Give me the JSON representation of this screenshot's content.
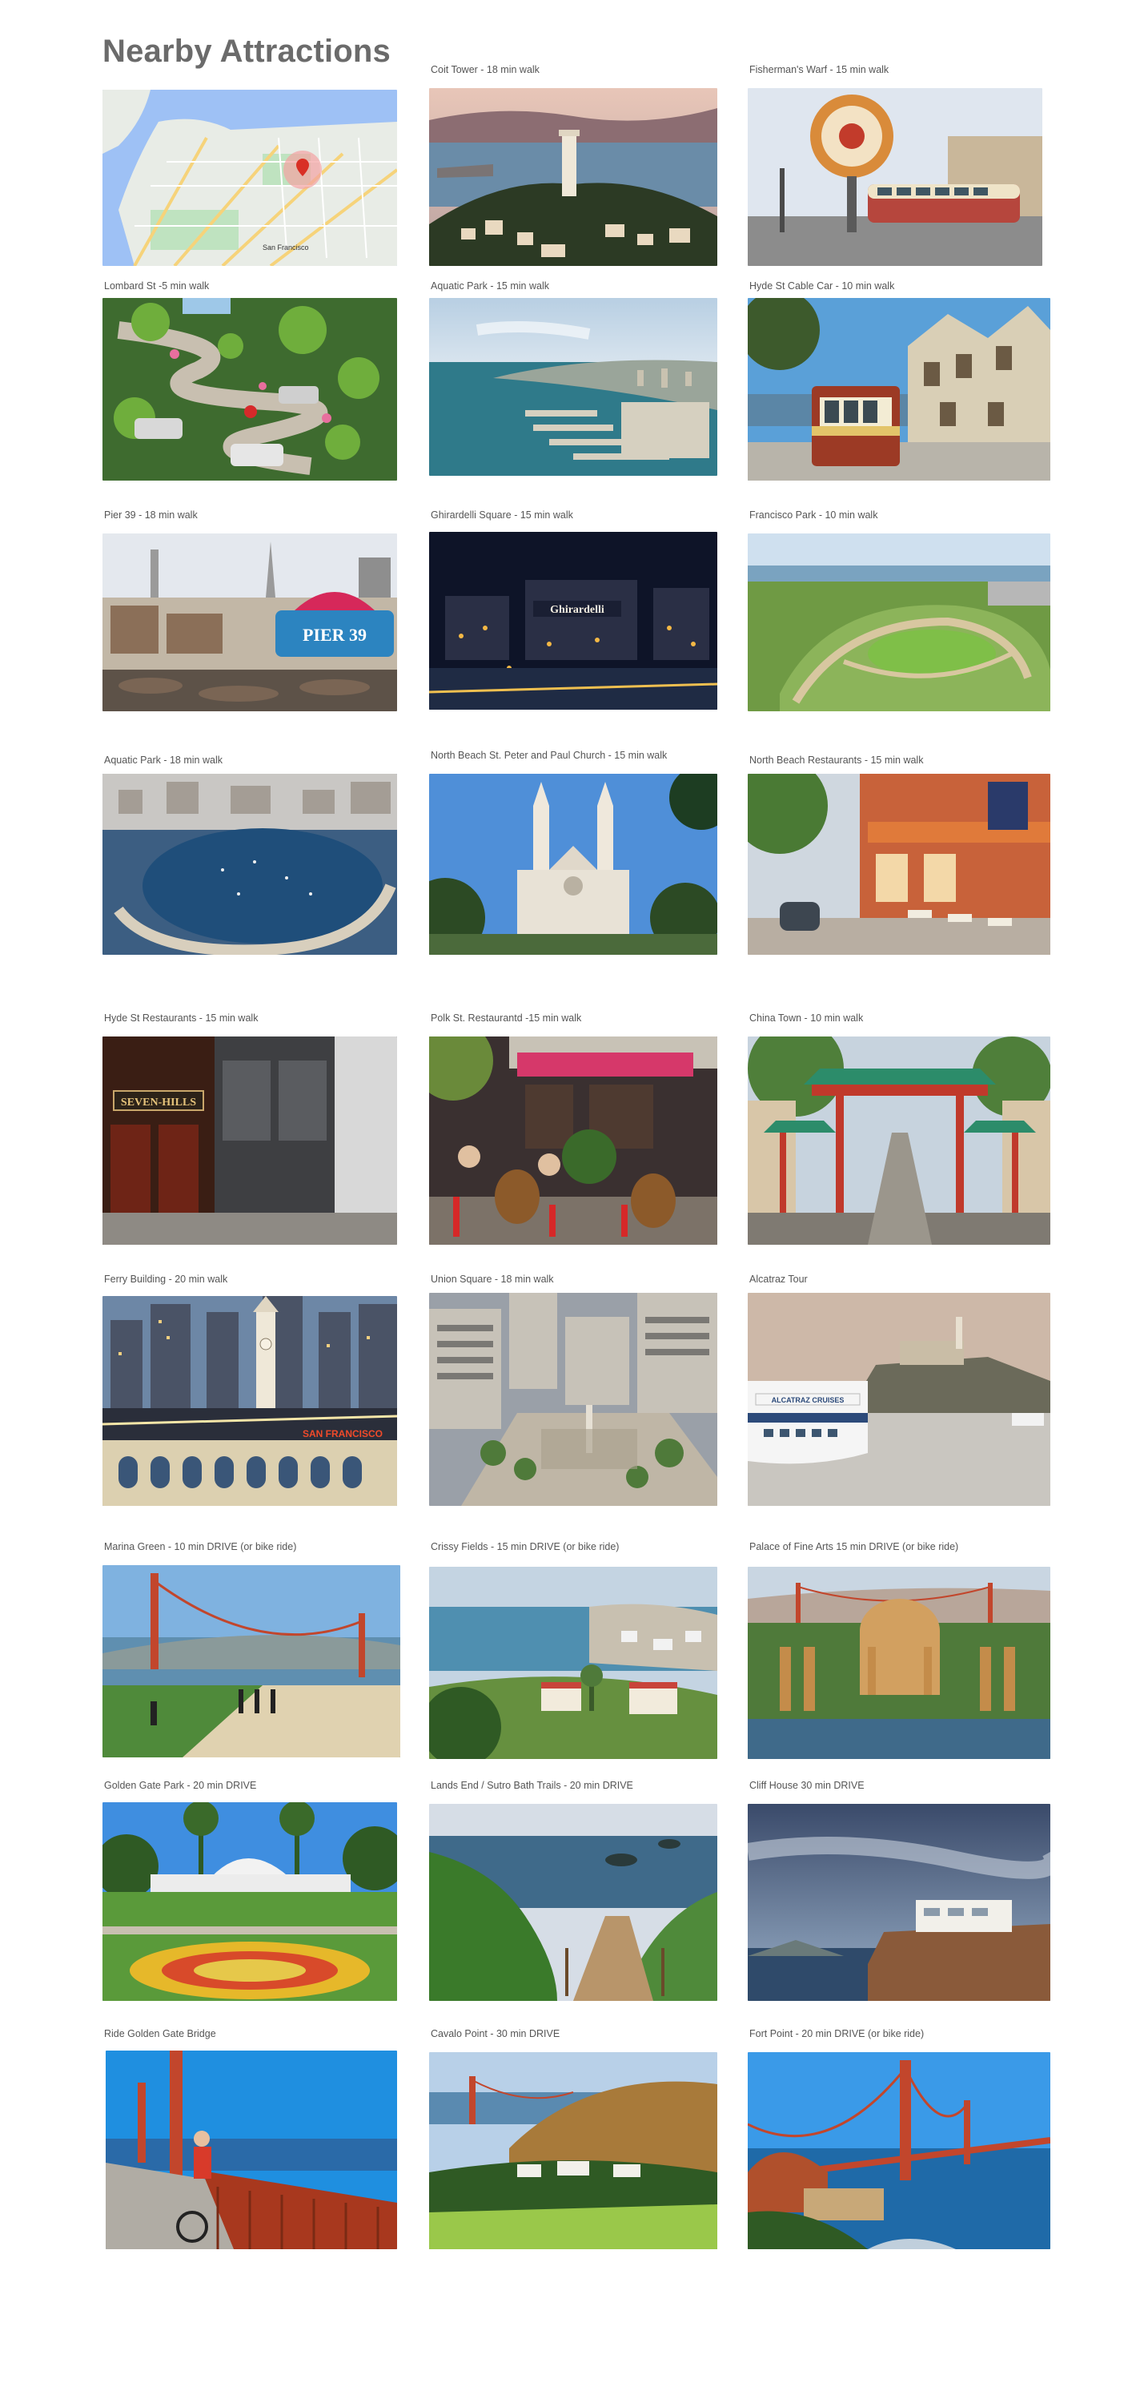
{
  "title": "Nearby Attractions",
  "attractions": [
    {
      "caption": "",
      "image": "map-thumbnail"
    },
    {
      "caption": "Coit Tower - 18 min walk",
      "image": "coit-tower-photo"
    },
    {
      "caption": "Fisherman's Warf - 15 min walk",
      "image": "fishermans-wharf-photo"
    },
    {
      "caption": "Lombard St -5 min walk",
      "image": "lombard-street-photo"
    },
    {
      "caption": "Aquatic Park - 15 min walk",
      "image": "aquatic-park-aerial-photo"
    },
    {
      "caption": "Hyde St Cable Car - 10 min walk",
      "image": "cable-car-photo"
    },
    {
      "caption": "Pier 39 - 18 min walk",
      "image": "pier-39-photo"
    },
    {
      "caption": "Ghirardelli Square - 15 min walk",
      "image": "ghirardelli-square-photo"
    },
    {
      "caption": "Francisco Park - 10 min walk",
      "image": "francisco-park-photo"
    },
    {
      "caption": "Aquatic Park - 18 min walk",
      "image": "aquatic-park-cove-photo"
    },
    {
      "caption": "North Beach St. Peter and Paul Church - 15 min walk",
      "image": "church-photo"
    },
    {
      "caption": "North Beach Restaurants - 15 min walk",
      "image": "north-beach-restaurants-photo"
    },
    {
      "caption": "Hyde St Restaurants - 15 min walk",
      "image": "hyde-st-restaurants-photo"
    },
    {
      "caption": "Polk St. Restaurantd -15 min walk",
      "image": "polk-st-restaurants-photo"
    },
    {
      "caption": "China Town - 10 min walk",
      "image": "chinatown-gate-photo"
    },
    {
      "caption": "Ferry Building - 20 min walk",
      "image": "ferry-building-photo"
    },
    {
      "caption": "Union Square - 18 min walk",
      "image": "union-square-photo"
    },
    {
      "caption": "Alcatraz Tour",
      "image": "alcatraz-tour-photo"
    },
    {
      "caption": "Marina Green - 10 min DRIVE (or bike ride)",
      "image": "marina-green-photo"
    },
    {
      "caption": "Crissy Fields - 15 min DRIVE (or bike ride)",
      "image": "crissy-field-photo"
    },
    {
      "caption": "Palace of Fine Arts 15 min DRIVE (or bike ride)",
      "image": "palace-of-fine-arts-photo"
    },
    {
      "caption": "Golden Gate Park - 20 min DRIVE",
      "image": "golden-gate-park-photo"
    },
    {
      "caption": "Lands End / Sutro Bath Trails - 20 min DRIVE",
      "image": "lands-end-photo"
    },
    {
      "caption": "Cliff House 30 min DRIVE",
      "image": "cliff-house-photo"
    },
    {
      "caption": "Ride Golden Gate Bridge",
      "image": "bike-golden-gate-photo"
    },
    {
      "caption": "Cavalo Point - 30 min DRIVE",
      "image": "cavallo-point-photo"
    },
    {
      "caption": "Fort Point - 20 min DRIVE (or bike ride)",
      "image": "fort-point-photo"
    }
  ],
  "image_text": {
    "pier_sign": "PIER 39",
    "ghirardelli_sign": "Ghirardelli",
    "seven_hills_sign": "SEVEN-HILLS",
    "ferry_sign": "SAN FRANCISCO",
    "alcatraz_boat": "ALCATRAZ CRUISES",
    "map_label": "San Francisco"
  }
}
